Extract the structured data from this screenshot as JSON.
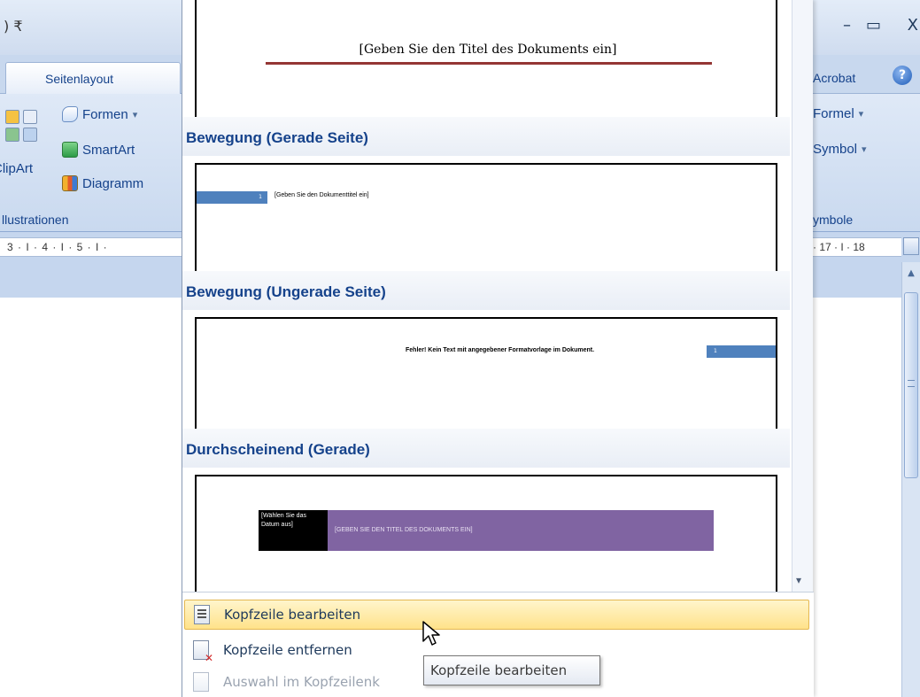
{
  "window": {
    "qat_glyph": ") ₹",
    "controls": {
      "minimize": "–",
      "maximize": "▭",
      "close": "X"
    }
  },
  "tabs": [
    {
      "label": "Seitenlayout"
    },
    {
      "label": "Acrobat"
    }
  ],
  "help": {
    "glyph": "?"
  },
  "ribbon": {
    "illustrations": {
      "label": "llustrationen",
      "clipart": "ClipArt",
      "formen": "Formen",
      "smartart": "SmartArt",
      "diagramm": "Diagramm"
    },
    "symbols": {
      "label": "ymbole",
      "formel": "Formel",
      "symbol": "Symbol"
    },
    "dropdown_caret": "▾"
  },
  "ruler": {
    "left_text": "3 · I · 4 · I · 5 · I ·",
    "right_text": "· 17 · I · 18"
  },
  "gallery": {
    "top_preview": {
      "title": "[Geben Sie den Titel des Dokuments ein]"
    },
    "sections": [
      {
        "heading": "Bewegung (Gerade Seite)",
        "page_number": "1",
        "text": "[Geben Sie den Dokumenttitel ein]"
      },
      {
        "heading": "Bewegung (Ungerade Seite)",
        "text": "Fehler! Kein Text mit angegebener Formatvorlage im Dokument.",
        "page_number": "1"
      },
      {
        "heading": "Durchscheinend (Gerade)",
        "date_text": "[Wählen Sie das Datum aus]",
        "title_text": "[GEBEN SIE DEN TITEL DES DOKUMENTS EIN]"
      }
    ],
    "scroll_arrow": "▾"
  },
  "commands": [
    {
      "label": "Kopfzeile bearbeiten",
      "state": "hover"
    },
    {
      "label": "Kopfzeile entfernen",
      "state": "normal"
    },
    {
      "label": "Auswahl im Kopfzeilenk",
      "state": "disabled"
    }
  ],
  "tooltip": {
    "text": "Kopfzeile bearbeiten"
  },
  "colors": {
    "heading": "#15428b",
    "blue_bar": "#4f81bd",
    "purple_bar": "#8064a2",
    "rule_red": "#943634",
    "hover_fill": "#ffe28a"
  }
}
